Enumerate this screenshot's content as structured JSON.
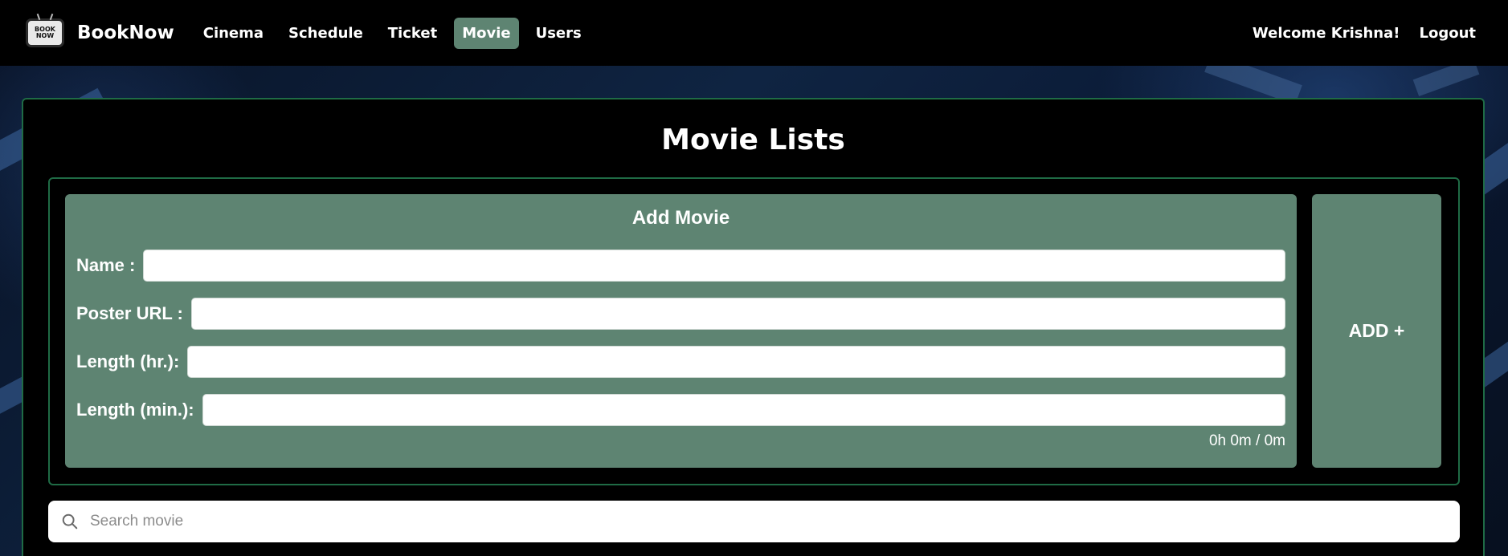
{
  "brand": {
    "name": "BookNow",
    "logo_text": "BOOK NOW"
  },
  "nav": {
    "items": [
      {
        "label": "Cinema"
      },
      {
        "label": "Schedule"
      },
      {
        "label": "Ticket"
      },
      {
        "label": "Movie",
        "active": true
      },
      {
        "label": "Users"
      }
    ],
    "welcome": "Welcome Krishna!",
    "logout": "Logout"
  },
  "page": {
    "title": "Movie Lists"
  },
  "add_movie": {
    "title": "Add Movie",
    "fields": {
      "name_label": "Name :",
      "name_value": "",
      "poster_label": "Poster URL :",
      "poster_value": "",
      "length_hr_label": "Length (hr.):",
      "length_hr_value": "",
      "length_min_label": "Length (min.):",
      "length_min_value": ""
    },
    "duration_summary": "0h 0m / 0m",
    "add_button": "ADD +"
  },
  "search": {
    "placeholder": "Search movie",
    "value": ""
  },
  "colors": {
    "navbar_bg": "#000000",
    "accent_green": "#5e8472",
    "border_green": "#1f6b45",
    "panel_bg": "#000000"
  }
}
